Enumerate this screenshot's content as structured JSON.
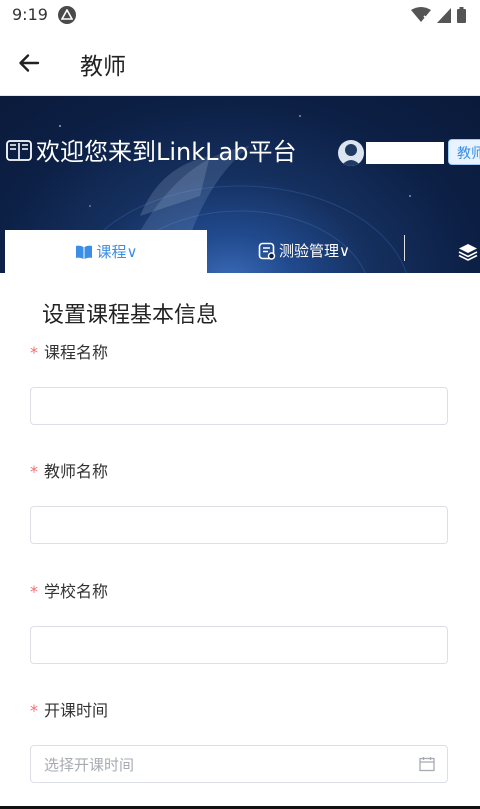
{
  "status_bar": {
    "time": "9:19"
  },
  "app_bar": {
    "title": "教师"
  },
  "banner": {
    "welcome": "欢迎您来到LinkLab平台",
    "role_badge": "教师"
  },
  "nav": {
    "tabs": [
      {
        "label": "课程∨",
        "active": true
      },
      {
        "label": "测验管理∨",
        "active": false
      }
    ]
  },
  "form": {
    "heading": "设置课程基本信息",
    "fields": [
      {
        "label": "课程名称",
        "value": "",
        "required": true
      },
      {
        "label": "教师名称",
        "value": "",
        "required": true
      },
      {
        "label": "学校名称",
        "value": "",
        "required": true
      },
      {
        "label": "开课时间",
        "placeholder": "选择开课时间",
        "required": true
      }
    ]
  },
  "colors": {
    "accent": "#3a8ee6",
    "required": "#f56c6c",
    "banner": "#0c1f44"
  }
}
